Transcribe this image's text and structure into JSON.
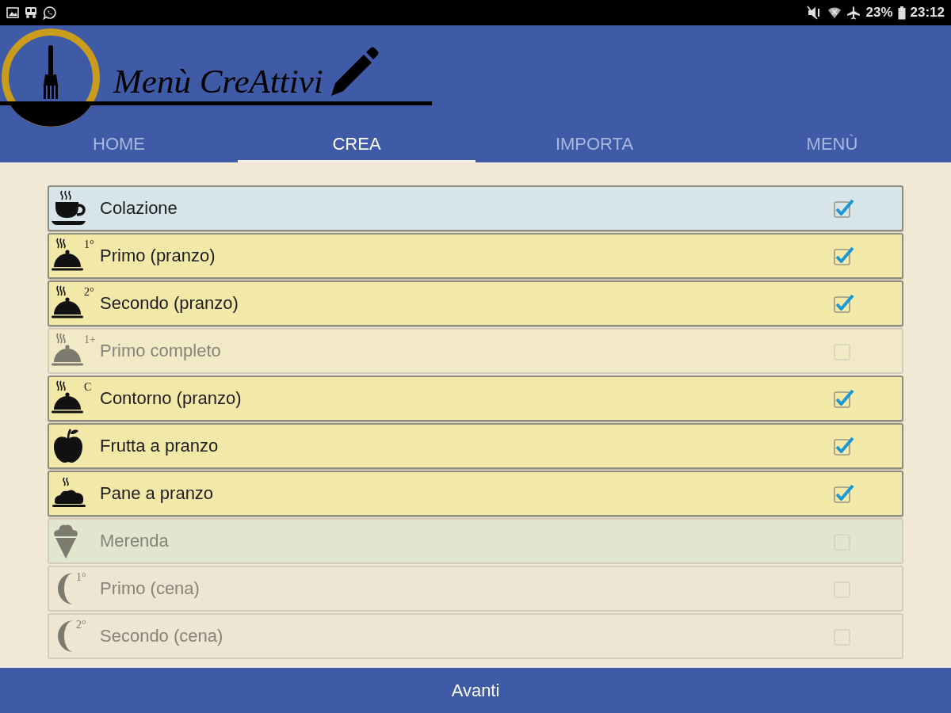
{
  "status_bar": {
    "battery": "23%",
    "time": "23:12"
  },
  "header": {
    "logo_text": "Menù CreAttivi"
  },
  "tabs": [
    {
      "label": "HOME",
      "selected": false
    },
    {
      "label": "CREA",
      "selected": true
    },
    {
      "label": "IMPORTA",
      "selected": false
    },
    {
      "label": "MENÙ",
      "selected": false
    }
  ],
  "meals": [
    {
      "label": "Colazione",
      "kind": "cup",
      "color": "#d7e5ea",
      "checked": true
    },
    {
      "label": "Primo (pranzo)",
      "kind": "cloche",
      "badge": "1°",
      "color": "#f2e9a9",
      "checked": true
    },
    {
      "label": "Secondo (pranzo)",
      "kind": "cloche",
      "badge": "2°",
      "color": "#f2e9a9",
      "checked": true
    },
    {
      "label": "Primo completo",
      "kind": "cloche",
      "badge": "1+",
      "color": "#f2e9c7",
      "checked": false
    },
    {
      "label": "Contorno (pranzo)",
      "kind": "cloche",
      "badge": "C",
      "color": "#f2e9a9",
      "checked": true
    },
    {
      "label": "Frutta a pranzo",
      "kind": "apple",
      "color": "#f2e9a9",
      "checked": true
    },
    {
      "label": "Pane a pranzo",
      "kind": "bread",
      "color": "#f2e9a9",
      "checked": true
    },
    {
      "label": "Merenda",
      "kind": "icecream",
      "color": "#e1e6cf",
      "checked": false
    },
    {
      "label": "Primo (cena)",
      "kind": "moon",
      "badge": "1°",
      "color": "#eee6d3",
      "checked": false
    },
    {
      "label": "Secondo (cena)",
      "kind": "moon",
      "badge": "2°",
      "color": "#eee6d3",
      "checked": false
    }
  ],
  "footer": {
    "button": "Avanti"
  }
}
